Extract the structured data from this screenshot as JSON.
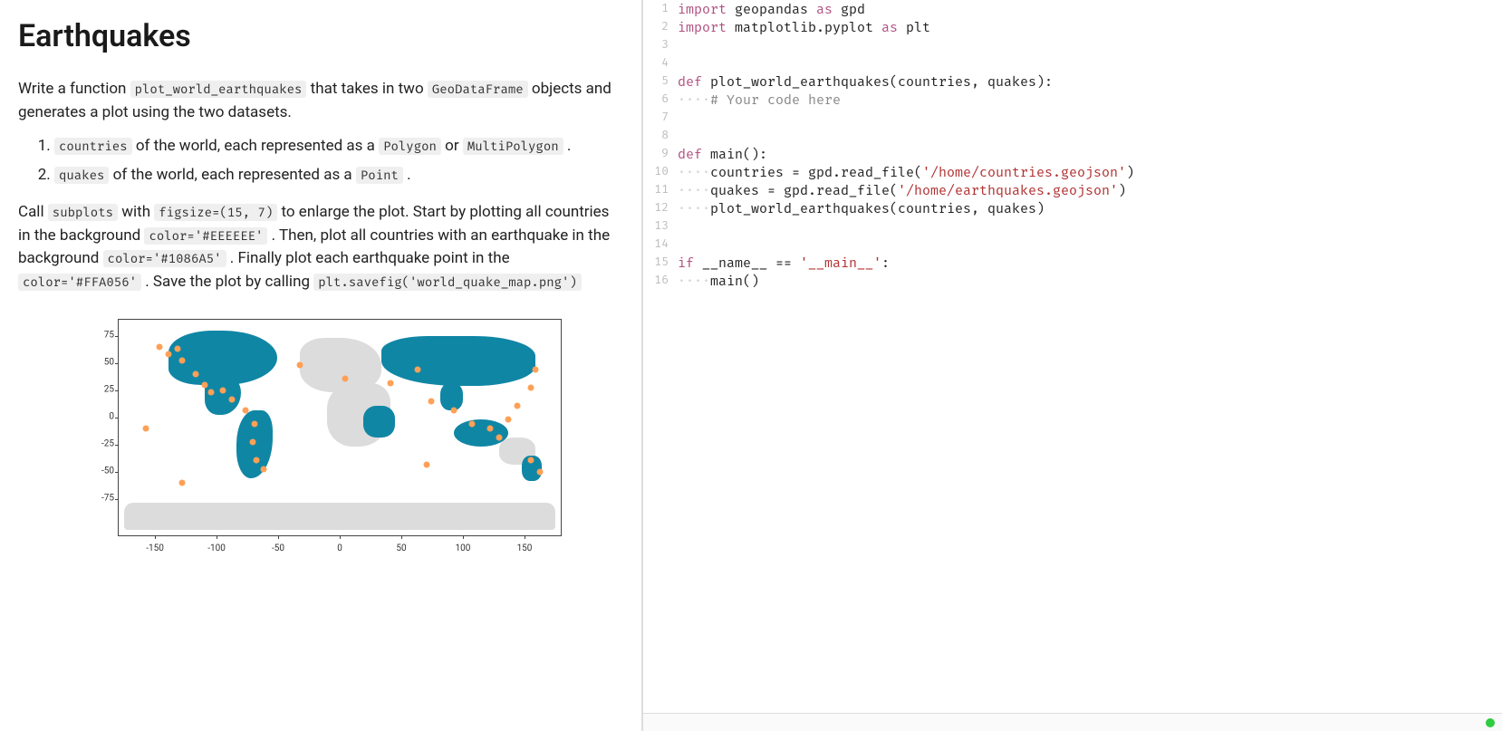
{
  "left": {
    "title": "Earthquakes",
    "p1_a": "Write a function ",
    "p1_code1": "plot_world_earthquakes",
    "p1_b": " that takes in two ",
    "p1_code2": "GeoDataFrame",
    "p1_c": " objects and generates a plot using the two datasets.",
    "li1_a": "countries",
    "li1_b": " of the world, each represented as a ",
    "li1_code1": "Polygon",
    "li1_c": " or ",
    "li1_code2": "MultiPolygon",
    "li1_d": " .",
    "li2_a": "quakes",
    "li2_b": " of the world, each represented as a ",
    "li2_code1": "Point",
    "li2_d": " .",
    "p2_a": "Call ",
    "p2_code1": "subplots",
    "p2_b": " with ",
    "p2_code2": "figsize=(15, 7)",
    "p2_c": " to enlarge the plot. Start by plotting all countries in the background ",
    "p2_code3": "color='#EEEEEE'",
    "p2_d": " . Then, plot all countries with an earthquake in the background ",
    "p2_code4": "color='#1086A5'",
    "p2_e": " . Finally plot each earthquake point in the ",
    "p2_code5": "color='#FFA056'",
    "p2_f": " . Save the plot by calling ",
    "p2_code6": "plt.savefig('world_quake_map.png')"
  },
  "map": {
    "yticks": [
      "75",
      "50",
      "25",
      "0",
      "-25",
      "-50",
      "-75"
    ],
    "xticks": [
      "-150",
      "-100",
      "-50",
      "0",
      "50",
      "100",
      "150"
    ],
    "colors": {
      "bg": "#EEEEEE",
      "hl": "#1086A5",
      "pt": "#FFA056"
    }
  },
  "code": {
    "lines": [
      {
        "n": 1,
        "t": [
          [
            "kw",
            "import"
          ],
          [
            "p",
            " geopandas "
          ],
          [
            "kw",
            "as"
          ],
          [
            "p",
            " gpd"
          ]
        ]
      },
      {
        "n": 2,
        "t": [
          [
            "kw",
            "import"
          ],
          [
            "p",
            " matplotlib.pyplot "
          ],
          [
            "kw",
            "as"
          ],
          [
            "p",
            " plt"
          ]
        ]
      },
      {
        "n": 3,
        "t": []
      },
      {
        "n": 4,
        "t": []
      },
      {
        "n": 5,
        "t": [
          [
            "kw",
            "def"
          ],
          [
            "p",
            " plot_world_earthquakes(countries, quakes):"
          ]
        ]
      },
      {
        "n": 6,
        "t": [
          [
            "indent",
            "····"
          ],
          [
            "cmt",
            "# Your code here"
          ]
        ]
      },
      {
        "n": 7,
        "t": []
      },
      {
        "n": 8,
        "t": []
      },
      {
        "n": 9,
        "t": [
          [
            "kw",
            "def"
          ],
          [
            "p",
            " main():"
          ]
        ]
      },
      {
        "n": 10,
        "t": [
          [
            "indent",
            "····"
          ],
          [
            "p",
            "countries = gpd.read_file("
          ],
          [
            "str",
            "'/home/countries.geojson'"
          ],
          [
            "p",
            ")"
          ]
        ]
      },
      {
        "n": 11,
        "t": [
          [
            "indent",
            "····"
          ],
          [
            "p",
            "quakes = gpd.read_file("
          ],
          [
            "str",
            "'/home/earthquakes.geojson'"
          ],
          [
            "p",
            ")"
          ]
        ]
      },
      {
        "n": 12,
        "t": [
          [
            "indent",
            "····"
          ],
          [
            "p",
            "plot_world_earthquakes(countries, quakes)"
          ]
        ]
      },
      {
        "n": 13,
        "t": []
      },
      {
        "n": 14,
        "t": []
      },
      {
        "n": 15,
        "t": [
          [
            "kw",
            "if"
          ],
          [
            "p",
            " __name__ == "
          ],
          [
            "str",
            "'__main__'"
          ],
          [
            "p",
            ":"
          ]
        ]
      },
      {
        "n": 16,
        "t": [
          [
            "indent",
            "····"
          ],
          [
            "p",
            "main()"
          ]
        ]
      }
    ]
  }
}
